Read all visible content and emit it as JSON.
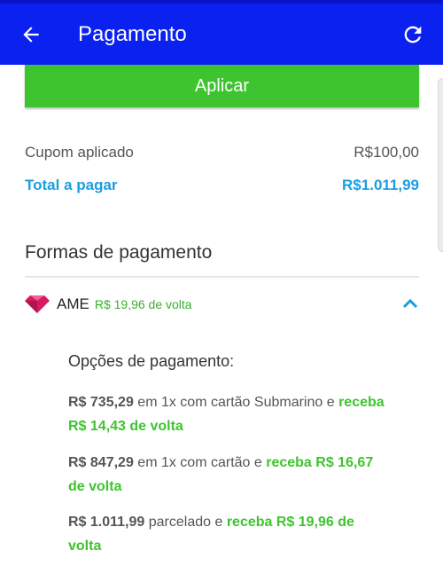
{
  "header": {
    "title": "Pagamento",
    "back_icon": "arrow-left-icon",
    "refresh_icon": "refresh-icon",
    "bg_color": "#0a21f0"
  },
  "apply_button": {
    "label": "Aplicar",
    "color": "#3ec42e"
  },
  "summary": {
    "coupon_label": "Cupom aplicado",
    "coupon_value": "R$100,00",
    "total_label": "Total a pagar",
    "total_value": "R$1.011,99"
  },
  "payment": {
    "section_title": "Formas de pagamento",
    "method": {
      "icon": "ame-gem-icon",
      "name": "AME",
      "cashback": "R$ 19,96 de volta"
    },
    "options_title": "Opções de pagamento:",
    "options": [
      {
        "price": "R$ 735,29",
        "text": " em 1x com cartão Submarino e ",
        "cashback": "receba R$ 14,43 de volta"
      },
      {
        "price": "R$ 847,29",
        "text": " em 1x com cartão e ",
        "cashback": "receba R$ 16,67 de volta"
      },
      {
        "price": "R$ 1.011,99",
        "text": " parcelado e ",
        "cashback": "receba R$ 19,96 de volta"
      }
    ]
  }
}
